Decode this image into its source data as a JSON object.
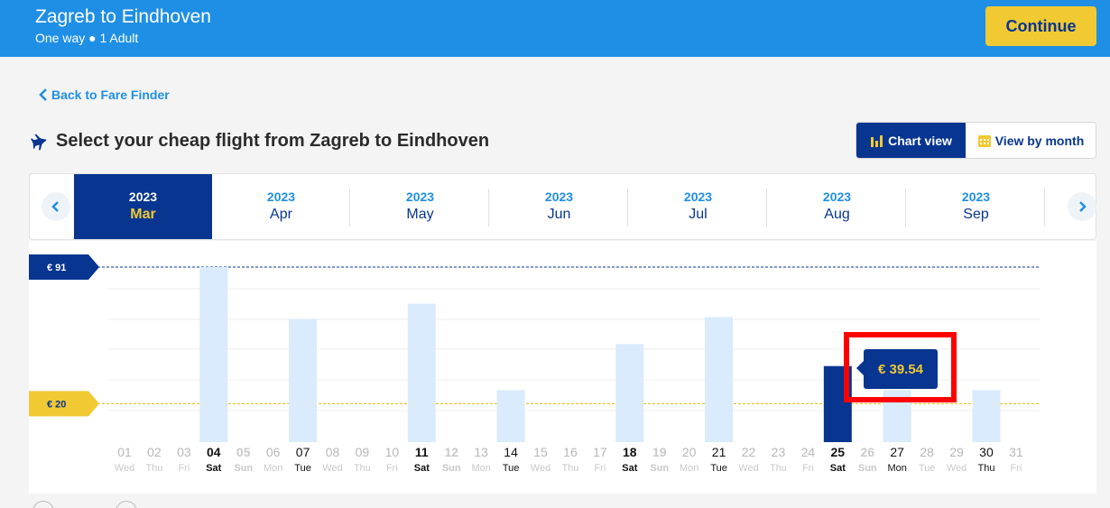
{
  "header": {
    "title": "Zagreb to Eindhoven",
    "subtitle": "One way ● 1 Adult",
    "continue_label": "Continue"
  },
  "back_link": "Back to Fare Finder",
  "page_title": "Select your cheap flight from Zagreb to Eindhoven",
  "view_toggle": {
    "chart_label": "Chart view",
    "month_label": "View by month",
    "selected": "chart"
  },
  "months": [
    {
      "year": "2023",
      "month": "Mar",
      "selected": true
    },
    {
      "year": "2023",
      "month": "Apr"
    },
    {
      "year": "2023",
      "month": "May"
    },
    {
      "year": "2023",
      "month": "Jun"
    },
    {
      "year": "2023",
      "month": "Jul"
    },
    {
      "year": "2023",
      "month": "Aug"
    },
    {
      "year": "2023",
      "month": "Sep"
    }
  ],
  "tooltip": "€ 39.54",
  "colors": {
    "brand_blue": "#073590",
    "header_blue": "#1f8fe5",
    "accent_yellow": "#f1c933",
    "bar_light": "#d9ebfc",
    "highlight": "#ff0000"
  },
  "chart_data": {
    "type": "bar",
    "max_label": "€ 91",
    "min_label": "€ 20",
    "ylim": [
      0,
      91
    ],
    "selected_day": "25",
    "days": [
      {
        "d": "01",
        "w": "Wed",
        "v": null,
        "avail": false
      },
      {
        "d": "02",
        "w": "Thu",
        "v": null,
        "avail": false
      },
      {
        "d": "03",
        "w": "Fri",
        "v": null,
        "avail": false
      },
      {
        "d": "04",
        "w": "Sat",
        "v": 91,
        "avail": true,
        "bold": true
      },
      {
        "d": "05",
        "w": "Sun",
        "v": null,
        "avail": false,
        "bold": true
      },
      {
        "d": "06",
        "w": "Mon",
        "v": null,
        "avail": false
      },
      {
        "d": "07",
        "w": "Tue",
        "v": 64,
        "avail": true
      },
      {
        "d": "08",
        "w": "Wed",
        "v": null,
        "avail": false
      },
      {
        "d": "09",
        "w": "Thu",
        "v": null,
        "avail": false
      },
      {
        "d": "10",
        "w": "Fri",
        "v": null,
        "avail": false
      },
      {
        "d": "11",
        "w": "Sat",
        "v": 72,
        "avail": true,
        "bold": true
      },
      {
        "d": "12",
        "w": "Sun",
        "v": null,
        "avail": false,
        "bold": true
      },
      {
        "d": "13",
        "w": "Mon",
        "v": null,
        "avail": false
      },
      {
        "d": "14",
        "w": "Tue",
        "v": 27,
        "avail": true
      },
      {
        "d": "15",
        "w": "Wed",
        "v": null,
        "avail": false
      },
      {
        "d": "16",
        "w": "Thu",
        "v": null,
        "avail": false
      },
      {
        "d": "17",
        "w": "Fri",
        "v": null,
        "avail": false
      },
      {
        "d": "18",
        "w": "Sat",
        "v": 51,
        "avail": true,
        "bold": true
      },
      {
        "d": "19",
        "w": "Sun",
        "v": null,
        "avail": false,
        "bold": true
      },
      {
        "d": "20",
        "w": "Mon",
        "v": null,
        "avail": false
      },
      {
        "d": "21",
        "w": "Tue",
        "v": 65,
        "avail": true
      },
      {
        "d": "22",
        "w": "Wed",
        "v": null,
        "avail": false
      },
      {
        "d": "23",
        "w": "Thu",
        "v": null,
        "avail": false
      },
      {
        "d": "24",
        "w": "Fri",
        "v": null,
        "avail": false
      },
      {
        "d": "25",
        "w": "Sat",
        "v": 39.54,
        "avail": true,
        "bold": true
      },
      {
        "d": "26",
        "w": "Sun",
        "v": null,
        "avail": false,
        "bold": true
      },
      {
        "d": "27",
        "w": "Mon",
        "v": 27,
        "avail": true
      },
      {
        "d": "28",
        "w": "Tue",
        "v": null,
        "avail": false
      },
      {
        "d": "29",
        "w": "Wed",
        "v": null,
        "avail": false
      },
      {
        "d": "30",
        "w": "Thu",
        "v": 27,
        "avail": true
      },
      {
        "d": "31",
        "w": "Fri",
        "v": null,
        "avail": false
      }
    ]
  }
}
